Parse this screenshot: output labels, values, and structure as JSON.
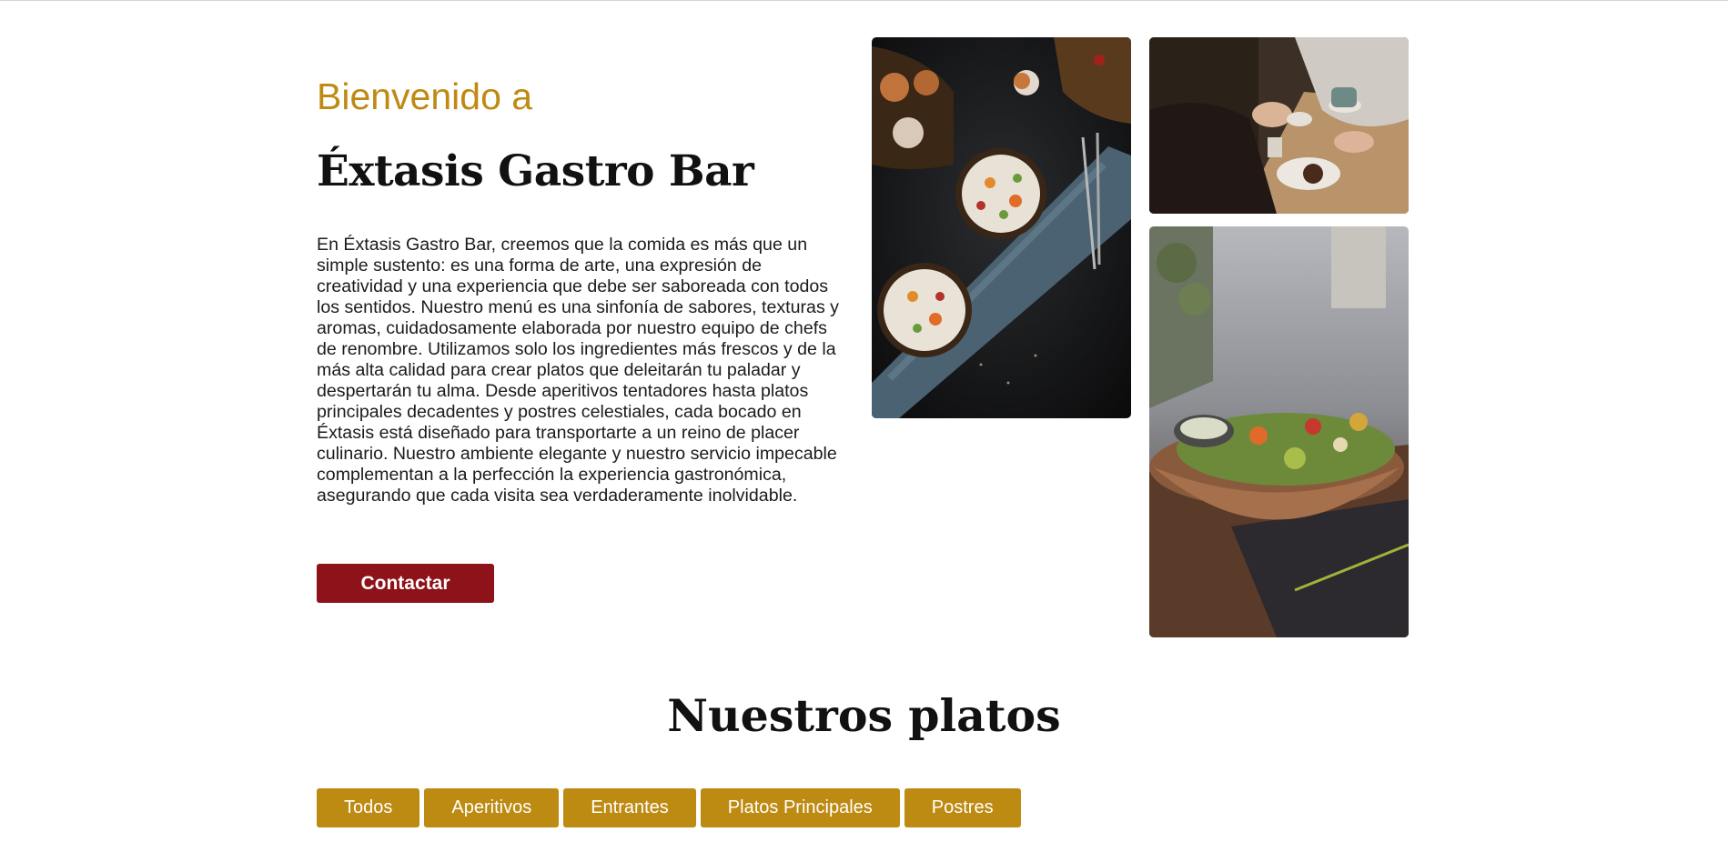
{
  "hero": {
    "welcome": "Bienvenido a",
    "title": "Éxtasis Gastro Bar",
    "description": "En Éxtasis Gastro Bar, creemos que la comida es más que un simple sustento: es una forma de arte, una expresión de creatividad y una experiencia que debe ser saboreada con todos los sentidos. Nuestro menú es una sinfonía de sabores, texturas y aromas, cuidadosamente elaborada por nuestro equipo de chefs de renombre. Utilizamos solo los ingredientes más frescos y de la más alta calidad para crear platos que deleitarán tu paladar y despertarán tu alma. Desde aperitivos tentadores hasta platos principales decadentes y postres celestiales, cada bocado en Éxtasis está diseñado para transportarte a un reino de placer culinario. Nuestro ambiente elegante y nuestro servicio impecable complementan a la perfección la experiencia gastronómica, asegurando que cada visita sea verdaderamente inolvidable.",
    "contact_label": "Contactar"
  },
  "colors": {
    "accent": "#bf8a12",
    "button": "#8e1219"
  },
  "menu": {
    "title": "Nuestros platos",
    "tabs": [
      {
        "label": "Todos"
      },
      {
        "label": "Aperitivos"
      },
      {
        "label": "Entrantes"
      },
      {
        "label": "Platos Principales"
      },
      {
        "label": "Postres"
      }
    ]
  }
}
